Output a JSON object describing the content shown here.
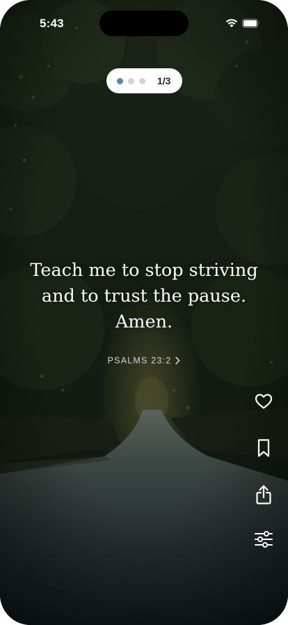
{
  "status_bar": {
    "time": "5:43",
    "icons": [
      "wifi-icon",
      "battery-icon"
    ]
  },
  "pager": {
    "count_label": "1/3",
    "total_pages": 3,
    "current_page": 1,
    "active_color": "#5b86ad",
    "inactive_color": "#d3d3d3"
  },
  "verse": {
    "lines": [
      "Teach me to stop striving",
      "and to trust the pause.",
      "Amen."
    ]
  },
  "reference": {
    "label": "PSALMS 23:2",
    "icon": "chevron-right-icon"
  },
  "actions": [
    {
      "name": "like",
      "icon": "heart-icon"
    },
    {
      "name": "bookmark",
      "icon": "bookmark-icon"
    },
    {
      "name": "share",
      "icon": "share-icon"
    },
    {
      "name": "settings",
      "icon": "sliders-icon"
    }
  ]
}
